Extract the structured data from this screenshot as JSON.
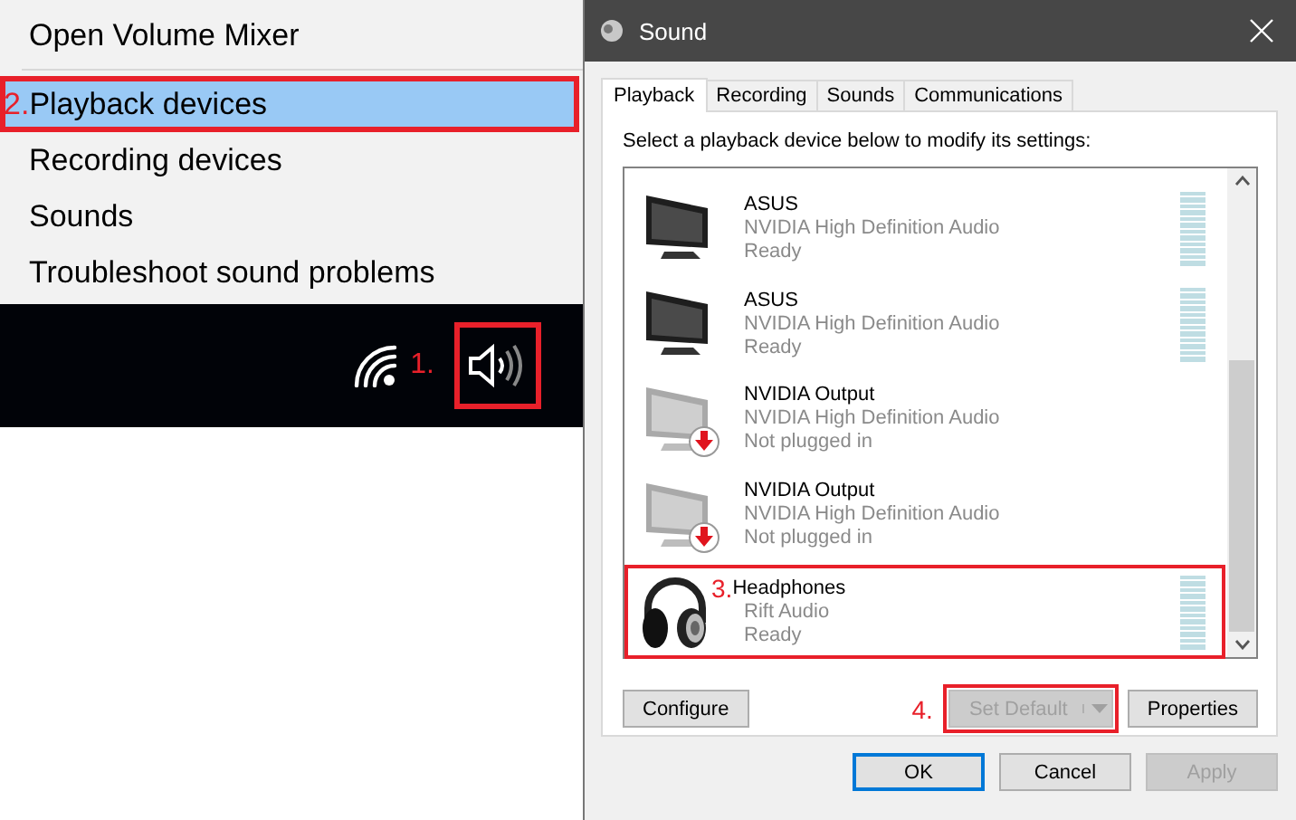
{
  "menu": {
    "items": [
      {
        "label": "Open Volume Mixer",
        "selected": false
      },
      {
        "label": "Playback devices",
        "selected": true,
        "marker": "2."
      },
      {
        "label": "Recording devices",
        "selected": false
      },
      {
        "label": "Sounds",
        "selected": false
      },
      {
        "label": "Troubleshoot sound problems",
        "selected": false
      }
    ]
  },
  "taskbar": {
    "speaker_marker": "1."
  },
  "window": {
    "title": "Sound"
  },
  "tabs": [
    {
      "label": "Playback",
      "selected": true
    },
    {
      "label": "Recording",
      "selected": false
    },
    {
      "label": "Sounds",
      "selected": false
    },
    {
      "label": "Communications",
      "selected": false
    }
  ],
  "instruction": "Select a playback device below to modify its settings:",
  "devices": [
    {
      "kind": "monitor",
      "name": "ASUS",
      "driver": "NVIDIA High Definition Audio",
      "status": "Ready",
      "unplugged": false
    },
    {
      "kind": "monitor",
      "name": "ASUS",
      "driver": "NVIDIA High Definition Audio",
      "status": "Ready",
      "unplugged": false
    },
    {
      "kind": "monitor",
      "name": "NVIDIA Output",
      "driver": "NVIDIA High Definition Audio",
      "status": "Not plugged in",
      "unplugged": true
    },
    {
      "kind": "monitor",
      "name": "NVIDIA Output",
      "driver": "NVIDIA High Definition Audio",
      "status": "Not plugged in",
      "unplugged": true
    },
    {
      "kind": "headphones",
      "name": "Headphones",
      "driver": "Rift Audio",
      "status": "Ready",
      "unplugged": false,
      "marker": "3."
    }
  ],
  "device_buttons": [
    {
      "label": "Configure",
      "disabled": false,
      "dropdown": false
    },
    {
      "label": "Set Default",
      "disabled": true,
      "dropdown": true,
      "marker": "4."
    },
    {
      "label": "Properties",
      "disabled": false,
      "dropdown": false
    }
  ],
  "dialog_buttons": [
    {
      "label": "OK",
      "disabled": false,
      "default": true
    },
    {
      "label": "Cancel",
      "disabled": false,
      "default": false
    },
    {
      "label": "Apply",
      "disabled": true,
      "default": false
    }
  ]
}
